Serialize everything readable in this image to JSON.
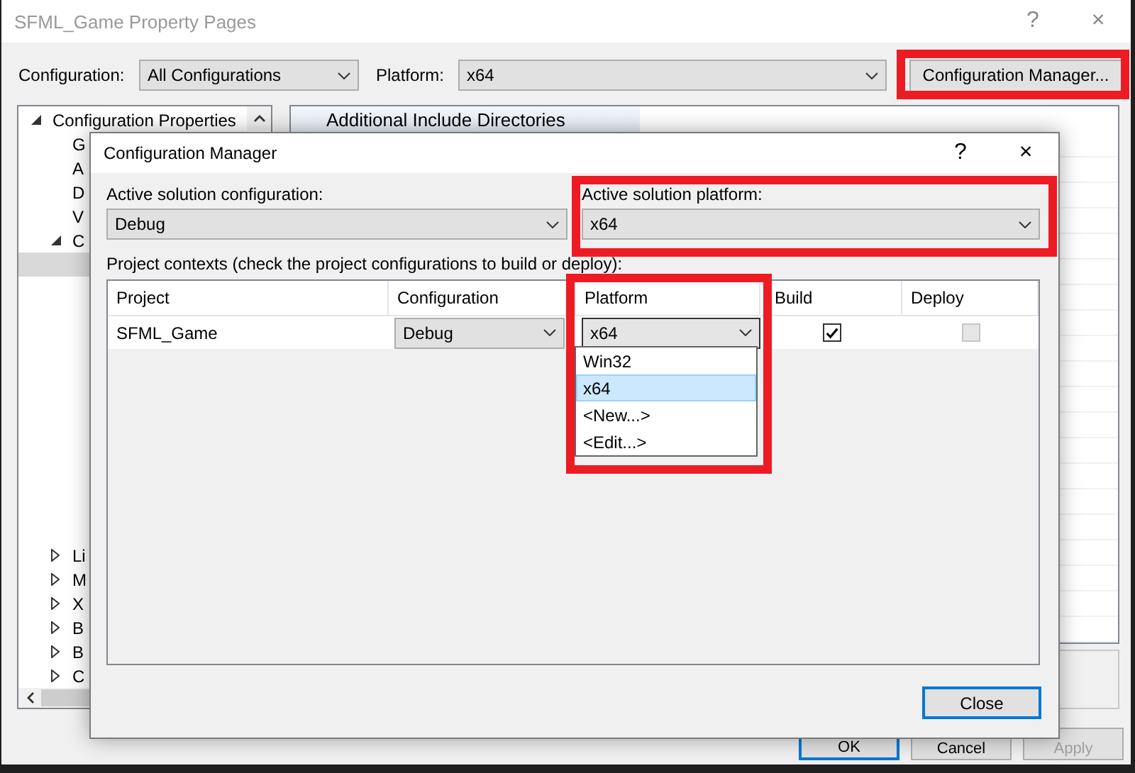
{
  "window": {
    "title": "SFML_Game Property Pages",
    "help": "?",
    "close": "×"
  },
  "toolbar": {
    "configuration_label": "Configuration:",
    "configuration": "All Configurations",
    "platform_label": "Platform:",
    "platform": "x64",
    "manager_button": "Configuration Manager..."
  },
  "tree": [
    {
      "label": "Configuration Properties",
      "expanded": true,
      "selected": false,
      "children": [
        {
          "label": "G",
          "selected": false
        },
        {
          "label": "A",
          "selected": false
        },
        {
          "label": "D",
          "selected": false
        },
        {
          "label": "V",
          "selected": false
        },
        {
          "label": "C",
          "expanded": true,
          "selected": false,
          "children": [
            {
              "selected": true
            }
          ]
        },
        {
          "label": "Li",
          "expanded": false,
          "selected": false
        },
        {
          "label": "M",
          "expanded": false,
          "selected": false
        },
        {
          "label": "X",
          "expanded": false,
          "selected": false
        },
        {
          "label": "B",
          "expanded": false,
          "selected": false
        },
        {
          "label": "B",
          "expanded": false,
          "selected": false
        },
        {
          "label": "C",
          "expanded": false,
          "selected": false
        }
      ]
    }
  ],
  "property_grid": {
    "header": "Additional Include Directories"
  },
  "buttons": [
    {
      "label": "OK",
      "default": true,
      "disabled": false
    },
    {
      "label": "Cancel",
      "default": false,
      "disabled": false
    },
    {
      "label": "Apply",
      "default": false,
      "disabled": true
    }
  ],
  "config_manager": {
    "title": "Configuration Manager",
    "help": "?",
    "close": "×",
    "active_configuration_label": "Active solution configuration:",
    "active_configuration": "Debug",
    "active_platform_label": "Active solution platform:",
    "active_platform": "x64",
    "contexts_label": "Project contexts (check the project configurations to build or deploy):",
    "columns": [
      "Project",
      "Configuration",
      "Platform",
      "Build",
      "Deploy"
    ],
    "rows": [
      {
        "project": "SFML_Game",
        "configuration": "Debug",
        "platform": "x64",
        "build": true,
        "deploy": false,
        "deploy_disabled": true
      }
    ],
    "platform_options": [
      {
        "label": "Win32",
        "selected": false
      },
      {
        "label": "x64",
        "selected": true
      },
      {
        "label": "<New...>",
        "selected": false
      },
      {
        "label": "<Edit...>",
        "selected": false
      }
    ],
    "close_button": "Close"
  }
}
